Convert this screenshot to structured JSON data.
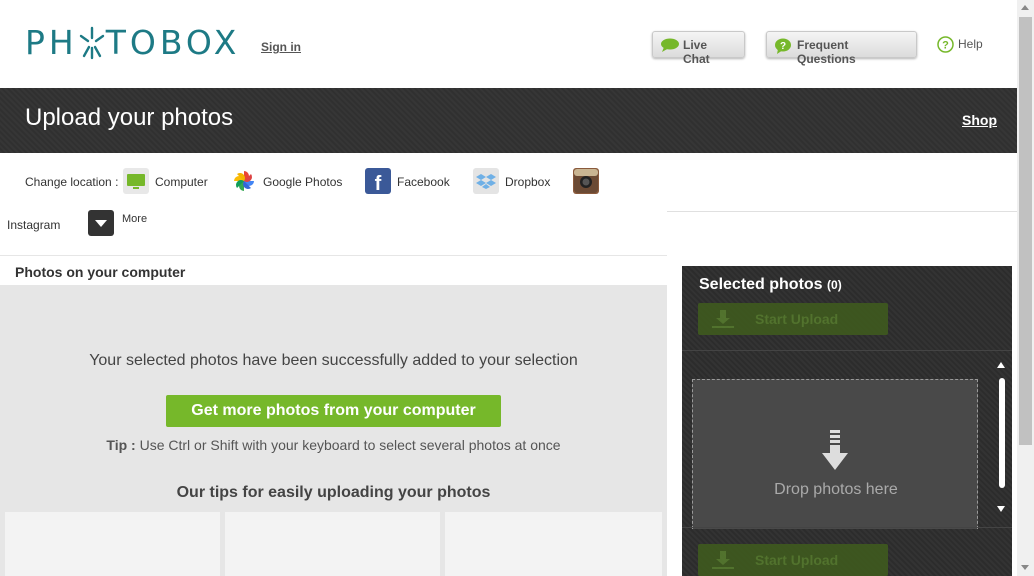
{
  "header": {
    "logo_text": "PHOTOBOX",
    "sign_in": "Sign in",
    "live_chat": "Live Chat",
    "faq": "Frequent Questions",
    "help": "Help"
  },
  "banner": {
    "title": "Upload your photos",
    "shop": "Shop"
  },
  "location": {
    "label": "Change location :",
    "sources": [
      {
        "label": "Computer",
        "icon": "monitor-icon",
        "color": "#76b82a"
      },
      {
        "label": "Google Photos",
        "icon": "google-photos-icon",
        "color": "#ea4335"
      },
      {
        "label": "Facebook",
        "icon": "facebook-icon",
        "color": "#3b5998"
      },
      {
        "label": "Dropbox",
        "icon": "dropbox-icon",
        "color": "#6fb0e6"
      },
      {
        "label": "Instagram",
        "icon": "instagram-icon",
        "color": "#8a5a3c"
      },
      {
        "label": "More",
        "icon": "more-chevron-icon",
        "color": "#333333"
      }
    ]
  },
  "section": {
    "title": "Photos on your computer"
  },
  "main": {
    "success_message": "Your selected photos have been successfully added to your selection",
    "get_more_button": "Get more photos from your computer",
    "tip_label": "Tip :",
    "tip_text": " Use Ctrl or Shift with your keyboard to select several photos at once",
    "tips_title": "Our tips for easily uploading your photos"
  },
  "selected": {
    "title": "Selected photos",
    "count": "(0)",
    "start_upload": "Start Upload",
    "drop_text": "Drop photos here"
  },
  "colors": {
    "brand": "#1d7a85",
    "accent_green": "#76b82a",
    "dark_banner": "#333333"
  }
}
